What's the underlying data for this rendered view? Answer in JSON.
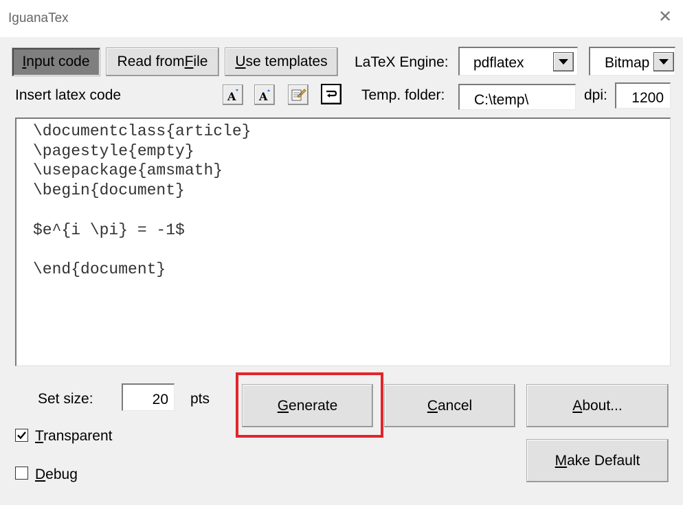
{
  "window": {
    "title": "IguanaTex",
    "close_glyph": "✕"
  },
  "toolbar": {
    "input_code": {
      "pre": "",
      "key": "I",
      "post": "nput code"
    },
    "read_from_file": {
      "pre": "Read from ",
      "key": "F",
      "post": "ile"
    },
    "use_templates": {
      "pre": "",
      "key": "U",
      "post": "se templates"
    },
    "engine_label": "LaTeX Engine:",
    "engine_value": "pdflatex",
    "output_value": "Bitmap",
    "insert_label": "Insert latex code",
    "temp_label": "Temp. folder:",
    "temp_value": "C:\\temp\\",
    "dpi_label": "dpi:",
    "dpi_value": "1200",
    "icons": [
      "font-decrease-icon",
      "font-increase-icon",
      "insert-snippet-icon",
      "word-wrap-icon"
    ]
  },
  "editor": {
    "code": "\\documentclass{article}\n\\pagestyle{empty}\n\\usepackage{amsmath}\n\\begin{document}\n\n$e^{i \\pi} = -1$\n\n\\end{document}"
  },
  "bottom": {
    "size_label": "Set size:",
    "size_value": "20",
    "size_unit": "pts",
    "transparent": {
      "pre": "",
      "key": "T",
      "post": "ransparent",
      "checked": true
    },
    "debug": {
      "pre": "",
      "key": "D",
      "post": "ebug",
      "checked": false
    },
    "generate": {
      "pre": "",
      "key": "G",
      "post": "enerate"
    },
    "cancel": {
      "pre": "",
      "key": "C",
      "post": "ancel"
    },
    "about": {
      "pre": "",
      "key": "A",
      "post": "bout..."
    },
    "make_default": {
      "pre": "",
      "key": "M",
      "post": "ake Default"
    }
  },
  "colors": {
    "highlight": "#e3242b",
    "pressed_button": "#7f7f7f",
    "background": "#f0f0f0"
  }
}
